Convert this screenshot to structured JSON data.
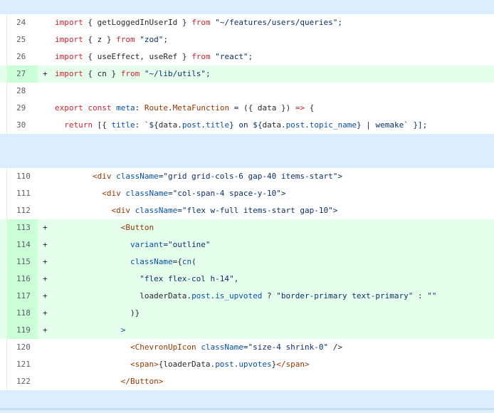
{
  "diff": {
    "block1": [
      {
        "num": "24",
        "sign": "",
        "type": "ctx",
        "segments": [
          {
            "t": "import",
            "c": "kw"
          },
          {
            "t": " { getLoggedInUserId } ",
            "c": "id"
          },
          {
            "t": "from",
            "c": "kw"
          },
          {
            "t": " \"~/features/users/queries\";",
            "c": "str"
          }
        ]
      },
      {
        "num": "25",
        "sign": "",
        "type": "ctx",
        "segments": [
          {
            "t": "import",
            "c": "kw"
          },
          {
            "t": " { z } ",
            "c": "id"
          },
          {
            "t": "from",
            "c": "kw"
          },
          {
            "t": " \"zod\";",
            "c": "str"
          }
        ]
      },
      {
        "num": "26",
        "sign": "",
        "type": "ctx",
        "segments": [
          {
            "t": "import",
            "c": "kw"
          },
          {
            "t": " { useEffect, useRef } ",
            "c": "id"
          },
          {
            "t": "from",
            "c": "kw"
          },
          {
            "t": " \"react\";",
            "c": "str"
          }
        ]
      },
      {
        "num": "27",
        "sign": "+",
        "type": "add",
        "segments": [
          {
            "t": "import",
            "c": "kw"
          },
          {
            "t": " { cn } ",
            "c": "id"
          },
          {
            "t": "from",
            "c": "kw"
          },
          {
            "t": " \"~/lib/utils\";",
            "c": "str"
          }
        ]
      },
      {
        "num": "28",
        "sign": "",
        "type": "ctx",
        "segments": []
      },
      {
        "num": "29",
        "sign": "",
        "type": "ctx",
        "segments": [
          {
            "t": "export",
            "c": "kw"
          },
          {
            "t": " ",
            "c": "id"
          },
          {
            "t": "const",
            "c": "kw"
          },
          {
            "t": " ",
            "c": "id"
          },
          {
            "t": "meta",
            "c": "prop"
          },
          {
            "t": ": ",
            "c": "id"
          },
          {
            "t": "Route",
            "c": "tag"
          },
          {
            "t": ".",
            "c": "id"
          },
          {
            "t": "MetaFunction",
            "c": "tag"
          },
          {
            "t": " = ({ data }) ",
            "c": "id"
          },
          {
            "t": "=>",
            "c": "kw"
          },
          {
            "t": " {",
            "c": "id"
          }
        ]
      },
      {
        "num": "30",
        "sign": "",
        "type": "ctx",
        "segments": [
          {
            "t": "  ",
            "c": "id"
          },
          {
            "t": "return",
            "c": "kw"
          },
          {
            "t": " [{ ",
            "c": "id"
          },
          {
            "t": "title",
            "c": "prop"
          },
          {
            "t": ": `${",
            "c": "tpl"
          },
          {
            "t": "data",
            "c": "id"
          },
          {
            "t": ".",
            "c": "id"
          },
          {
            "t": "post",
            "c": "prop"
          },
          {
            "t": ".",
            "c": "id"
          },
          {
            "t": "title",
            "c": "prop"
          },
          {
            "t": "} on ${",
            "c": "tpl"
          },
          {
            "t": "data",
            "c": "id"
          },
          {
            "t": ".",
            "c": "id"
          },
          {
            "t": "post",
            "c": "prop"
          },
          {
            "t": ".",
            "c": "id"
          },
          {
            "t": "topic_name",
            "c": "prop"
          },
          {
            "t": "} | wemake` }];",
            "c": "tpl"
          }
        ]
      }
    ],
    "block2": [
      {
        "num": "110",
        "sign": "",
        "type": "ctx",
        "segments": [
          {
            "t": "        <div ",
            "c": "tag"
          },
          {
            "t": "className",
            "c": "attr"
          },
          {
            "t": "=\"grid grid-cols-6 gap-40 items-start\">",
            "c": "str"
          }
        ]
      },
      {
        "num": "111",
        "sign": "",
        "type": "ctx",
        "segments": [
          {
            "t": "          <div ",
            "c": "tag"
          },
          {
            "t": "className",
            "c": "attr"
          },
          {
            "t": "=\"col-span-4 space-y-10\">",
            "c": "str"
          }
        ]
      },
      {
        "num": "112",
        "sign": "",
        "type": "ctx",
        "segments": [
          {
            "t": "            <div ",
            "c": "tag"
          },
          {
            "t": "className",
            "c": "attr"
          },
          {
            "t": "=\"flex w-full items-start gap-10\">",
            "c": "str"
          }
        ]
      },
      {
        "num": "113",
        "sign": "+",
        "type": "add",
        "segments": [
          {
            "t": "              <Button",
            "c": "tag"
          }
        ]
      },
      {
        "num": "114",
        "sign": "+",
        "type": "add",
        "segments": [
          {
            "t": "                ",
            "c": "id"
          },
          {
            "t": "variant",
            "c": "attr"
          },
          {
            "t": "=\"outline\"",
            "c": "str"
          }
        ]
      },
      {
        "num": "115",
        "sign": "+",
        "type": "add",
        "segments": [
          {
            "t": "                ",
            "c": "id"
          },
          {
            "t": "className",
            "c": "attr"
          },
          {
            "t": "={",
            "c": "id"
          },
          {
            "t": "cn",
            "c": "prop"
          },
          {
            "t": "(",
            "c": "id"
          }
        ]
      },
      {
        "num": "116",
        "sign": "+",
        "type": "add",
        "segments": [
          {
            "t": "                  \"flex flex-col h-14\",",
            "c": "str"
          }
        ]
      },
      {
        "num": "117",
        "sign": "+",
        "type": "add",
        "segments": [
          {
            "t": "                  loaderData.",
            "c": "id"
          },
          {
            "t": "post",
            "c": "prop"
          },
          {
            "t": ".",
            "c": "id"
          },
          {
            "t": "is_upvoted",
            "c": "prop"
          },
          {
            "t": " ? ",
            "c": "id"
          },
          {
            "t": "\"border-primary text-primary\"",
            "c": "str"
          },
          {
            "t": " : ",
            "c": "id"
          },
          {
            "t": "\"\"",
            "c": "str"
          }
        ]
      },
      {
        "num": "118",
        "sign": "+",
        "type": "add",
        "segments": [
          {
            "t": "                )}",
            "c": "id"
          }
        ]
      },
      {
        "num": "119",
        "sign": "+",
        "type": "add",
        "segments": [
          {
            "t": "              >",
            "c": "prop"
          }
        ]
      },
      {
        "num": "120",
        "sign": "",
        "type": "ctx",
        "segments": [
          {
            "t": "                <ChevronUpIcon ",
            "c": "tag"
          },
          {
            "t": "className",
            "c": "attr"
          },
          {
            "t": "=\"size-4 shrink-0\"",
            "c": "str"
          },
          {
            "t": " />",
            "c": "id"
          }
        ]
      },
      {
        "num": "121",
        "sign": "",
        "type": "ctx",
        "segments": [
          {
            "t": "                <span>",
            "c": "tag"
          },
          {
            "t": "{loaderData.",
            "c": "id"
          },
          {
            "t": "post",
            "c": "prop"
          },
          {
            "t": ".",
            "c": "id"
          },
          {
            "t": "upvotes",
            "c": "prop"
          },
          {
            "t": "}",
            "c": "id"
          },
          {
            "t": "</span>",
            "c": "tag"
          }
        ]
      },
      {
        "num": "122",
        "sign": "",
        "type": "ctx",
        "segments": [
          {
            "t": "              </Button>",
            "c": "tag"
          }
        ]
      }
    ]
  },
  "colors": {
    "add_bg": "#e6ffec",
    "add_num_bg": "#ccffd8",
    "hunk_bg": "#dbedff",
    "keyword": "#cf222e",
    "string": "#0a3069",
    "property": "#0550ae",
    "tag": "#953800"
  }
}
